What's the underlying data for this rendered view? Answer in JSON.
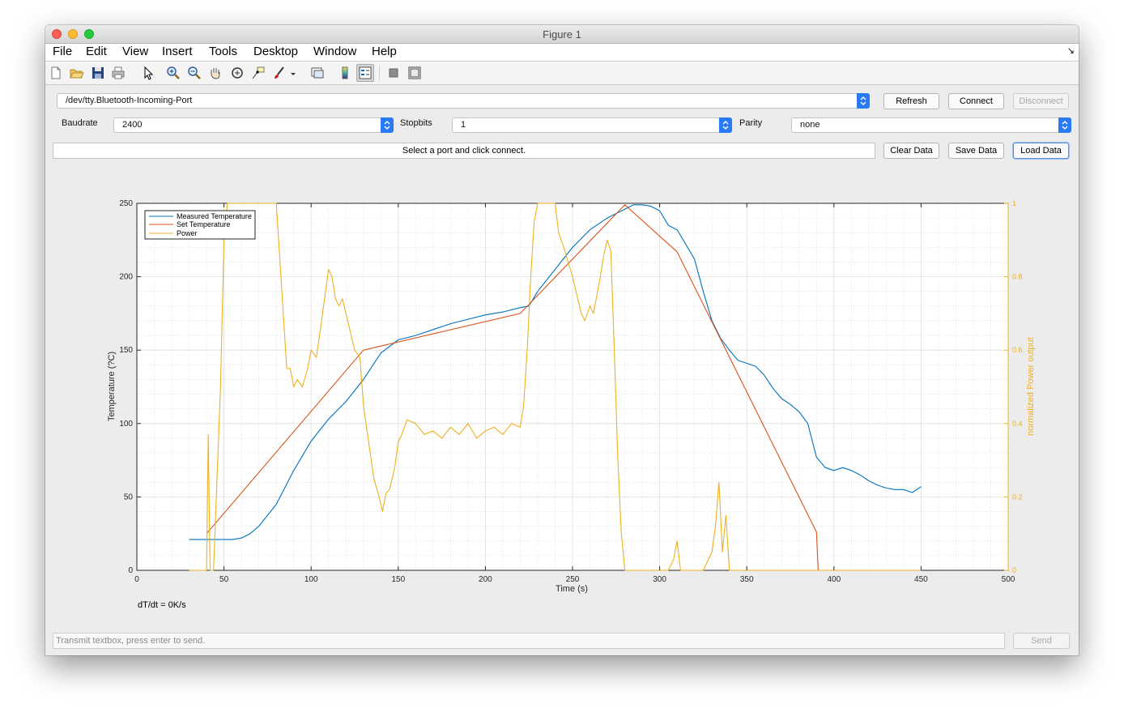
{
  "window": {
    "title": "Figure 1"
  },
  "menubar": {
    "items": [
      "File",
      "Edit",
      "View",
      "Insert",
      "Tools",
      "Desktop",
      "Window",
      "Help"
    ]
  },
  "toolbar": {
    "icons": [
      "new-figure-icon",
      "open-file-icon",
      "save-icon",
      "print-icon",
      "pointer-icon",
      "zoom-in-icon",
      "zoom-out-icon",
      "pan-icon",
      "rotate-3d-icon",
      "data-cursor-icon",
      "brush-icon",
      "brush-dropdown-icon",
      "link-plot-icon",
      "colorbar-icon",
      "legend-icon",
      "hide-plot-tools-icon",
      "show-plot-tools-icon"
    ]
  },
  "port": {
    "value": "/dev/tty.Bluetooth-Incoming-Port"
  },
  "buttons": {
    "refresh": "Refresh",
    "connect": "Connect",
    "disconnect": "Disconnect",
    "clear": "Clear Data",
    "save": "Save Data",
    "load": "Load Data",
    "send": "Send"
  },
  "settings": {
    "baudrate_label": "Baudrate",
    "baudrate_value": "2400",
    "stopbits_label": "Stopbits",
    "stopbits_value": "1",
    "parity_label": "Parity",
    "parity_value": "none"
  },
  "status": {
    "message": "Select a port and click connect."
  },
  "rate": {
    "text": "dT/dt = 0K/s"
  },
  "transmit": {
    "placeholder": "Transmit textbox, press enter to send."
  },
  "colors": {
    "measured": "#0072bd",
    "set": "#d95319",
    "power": "#edb120",
    "accent": "#2a7af7"
  },
  "chart_data": {
    "type": "line",
    "xlabel": "Time (s)",
    "ylabel": "Temperature (?C)",
    "y2label": "normalized Power output",
    "xlim": [
      0,
      500
    ],
    "ylim": [
      0,
      250
    ],
    "y2lim": [
      0,
      1
    ],
    "xticks": [
      0,
      50,
      100,
      150,
      200,
      250,
      300,
      350,
      400,
      450,
      500
    ],
    "yticks": [
      0,
      50,
      100,
      150,
      200,
      250
    ],
    "y2ticks": [
      0,
      0.2,
      0.4,
      0.6,
      0.8,
      1
    ],
    "grid": "major and minor",
    "legend_position": "top-left",
    "series": [
      {
        "name": "Measured Temperature",
        "axis": "left",
        "x": [
          30,
          40,
          55,
          60,
          65,
          70,
          80,
          90,
          100,
          110,
          120,
          130,
          140,
          150,
          160,
          170,
          180,
          190,
          200,
          210,
          220,
          225,
          230,
          240,
          250,
          260,
          270,
          280,
          285,
          290,
          295,
          300,
          305,
          310,
          315,
          320,
          325,
          330,
          335,
          340,
          345,
          350,
          355,
          360,
          365,
          370,
          375,
          380,
          385,
          390,
          395,
          400,
          405,
          410,
          415,
          420,
          425,
          430,
          435,
          440,
          445,
          450
        ],
        "y": [
          21,
          21,
          21,
          22,
          25,
          30,
          45,
          68,
          88,
          103,
          115,
          130,
          148,
          157,
          160,
          164,
          168,
          171,
          174,
          176,
          179,
          180,
          190,
          205,
          220,
          232,
          240,
          246,
          249,
          249,
          248,
          245,
          235,
          232,
          222,
          212,
          190,
          170,
          158,
          150,
          143,
          141,
          139,
          133,
          124,
          117,
          113,
          108,
          100,
          77,
          70,
          68,
          70,
          68,
          65,
          61,
          58,
          56,
          55,
          55,
          53,
          57
        ]
      },
      {
        "name": "Set Temperature",
        "axis": "left",
        "x": [
          40,
          130,
          220,
          280,
          310,
          390,
          391,
          400,
          450
        ],
        "y": [
          25,
          150,
          175,
          249,
          217,
          26,
          0,
          0,
          0
        ]
      },
      {
        "name": "Power",
        "axis": "right",
        "x": [
          30,
          40,
          41,
          42,
          43,
          44,
          48,
          50,
          52,
          55,
          80,
          82,
          84,
          86,
          88,
          90,
          92,
          95,
          98,
          100,
          103,
          106,
          108,
          110,
          112,
          114,
          116,
          118,
          120,
          122,
          125,
          128,
          130,
          133,
          136,
          139,
          141,
          143,
          145,
          148,
          150,
          152,
          155,
          160,
          165,
          170,
          175,
          180,
          185,
          190,
          195,
          200,
          205,
          210,
          215,
          220,
          222,
          224,
          226,
          228,
          230,
          232,
          234,
          236,
          238,
          240,
          242,
          245,
          250,
          255,
          257,
          260,
          262,
          264,
          266,
          268,
          270,
          272,
          274,
          276,
          278,
          280,
          282,
          285,
          288,
          300,
          305,
          308,
          310,
          312,
          320,
          325,
          330,
          332,
          334,
          336,
          338,
          340,
          350,
          360,
          400,
          450
        ],
        "y": [
          0,
          0,
          0.37,
          0,
          0,
          0,
          0.5,
          0.9,
          1,
          1,
          1,
          0.85,
          0.7,
          0.55,
          0.55,
          0.5,
          0.52,
          0.5,
          0.55,
          0.6,
          0.58,
          0.68,
          0.75,
          0.82,
          0.8,
          0.74,
          0.72,
          0.74,
          0.7,
          0.66,
          0.6,
          0.58,
          0.45,
          0.35,
          0.25,
          0.2,
          0.16,
          0.21,
          0.22,
          0.28,
          0.35,
          0.37,
          0.41,
          0.4,
          0.37,
          0.38,
          0.36,
          0.39,
          0.37,
          0.4,
          0.36,
          0.38,
          0.39,
          0.37,
          0.4,
          0.39,
          0.45,
          0.6,
          0.8,
          0.95,
          1,
          1,
          1,
          1,
          1,
          1,
          0.92,
          0.88,
          0.8,
          0.7,
          0.68,
          0.72,
          0.7,
          0.75,
          0.8,
          0.86,
          0.9,
          0.87,
          0.6,
          0.3,
          0.1,
          0,
          0,
          0,
          0,
          0,
          0,
          0.03,
          0.08,
          0,
          0,
          0,
          0.05,
          0.12,
          0.24,
          0.05,
          0.15,
          0,
          0,
          0,
          0,
          0
        ]
      }
    ]
  }
}
